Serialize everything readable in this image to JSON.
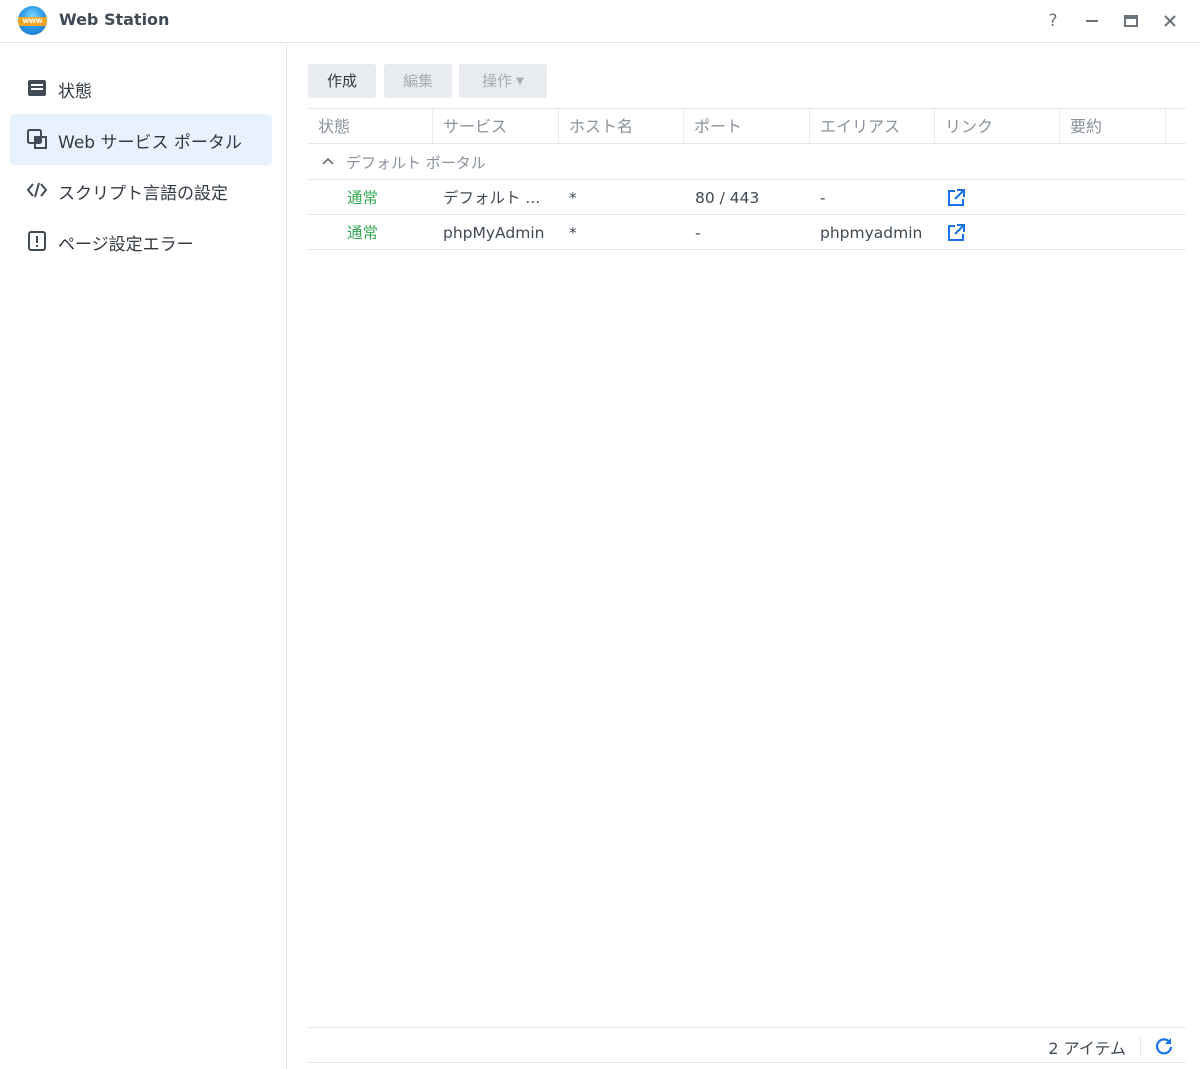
{
  "window": {
    "title": "Web Station",
    "logo_text": "WWW",
    "controls": {
      "help": "?"
    }
  },
  "sidebar": {
    "items": [
      {
        "label": "状態",
        "icon": "status-icon",
        "active": false
      },
      {
        "label": "Web サービス ポータル",
        "icon": "portal-icon",
        "active": true
      },
      {
        "label": "スクリプト言語の設定",
        "icon": "code-icon",
        "active": false
      },
      {
        "label": "ページ設定エラー",
        "icon": "error-page-icon",
        "active": false
      }
    ]
  },
  "toolbar": {
    "create_label": "作成",
    "edit_label": "編集",
    "action_label": "操作"
  },
  "table": {
    "columns": [
      "状態",
      "サービス",
      "ホスト名",
      "ポート",
      "エイリアス",
      "リンク",
      "要約"
    ],
    "group_label": "デフォルト ポータル",
    "rows": [
      {
        "status": "通常",
        "service": "デフォルト ...",
        "host": "*",
        "port": "80 / 443",
        "alias": "-",
        "link_icon": "external-link-icon"
      },
      {
        "status": "通常",
        "service": "phpMyAdmin",
        "host": "*",
        "port": "-",
        "alias": "phpmyadmin",
        "link_icon": "external-link-icon"
      }
    ]
  },
  "footer": {
    "item_count": "2 アイテム"
  },
  "colors": {
    "accent": "#1a73e8",
    "status_ok": "#34a853",
    "active_nav_bg": "#e8f2fc"
  }
}
